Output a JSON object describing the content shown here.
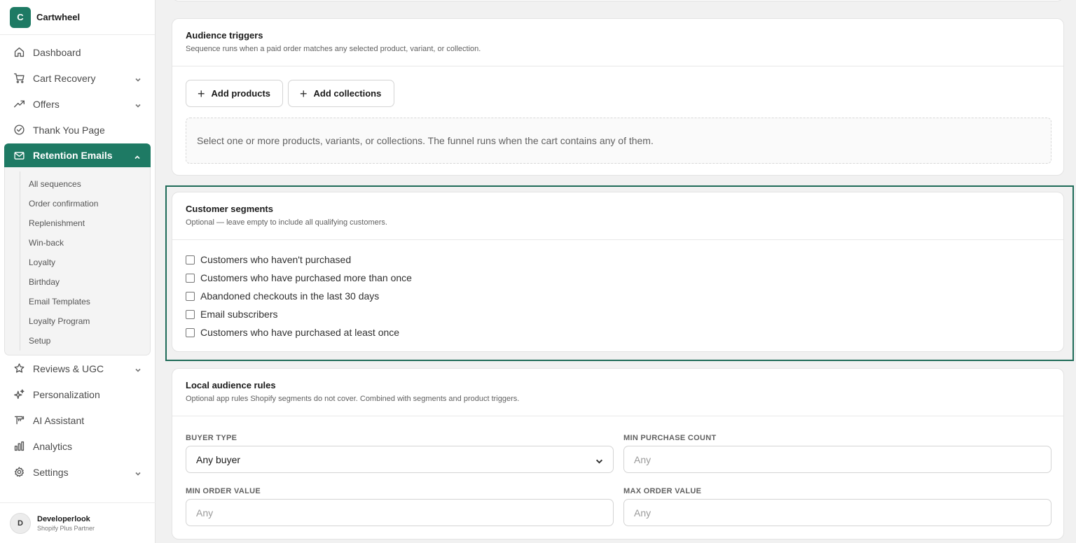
{
  "app": {
    "logo_letter": "C",
    "name": "Cartwheel"
  },
  "nav": {
    "dashboard": "Dashboard",
    "cart_recovery": "Cart Recovery",
    "offers": "Offers",
    "thank_you": "Thank You Page",
    "retention": "Retention Emails",
    "reviews": "Reviews & UGC",
    "personalization": "Personalization",
    "ai_assistant": "AI Assistant",
    "analytics": "Analytics",
    "settings": "Settings"
  },
  "subnav": [
    "All sequences",
    "Order confirmation",
    "Replenishment",
    "Win-back",
    "Loyalty",
    "Birthday",
    "Email Templates",
    "Loyalty Program",
    "Setup"
  ],
  "user": {
    "initial": "D",
    "name": "Developerlook",
    "role": "Shopify Plus Partner"
  },
  "audience": {
    "title": "Audience triggers",
    "subtitle": "Sequence runs when a paid order matches any selected product, variant, or collection.",
    "add_products": "Add products",
    "add_collections": "Add collections",
    "empty_hint": "Select one or more products, variants, or collections. The funnel runs when the cart contains any of them."
  },
  "segments": {
    "title": "Customer segments",
    "subtitle": "Optional — leave empty to include all qualifying customers.",
    "options": [
      "Customers who haven't purchased",
      "Customers who have purchased more than once",
      "Abandoned checkouts in the last 30 days",
      "Email subscribers",
      "Customers who have purchased at least once"
    ]
  },
  "local_rules": {
    "title": "Local audience rules",
    "subtitle": "Optional app rules Shopify segments do not cover. Combined with segments and product triggers.",
    "buyer_type_label": "BUYER TYPE",
    "buyer_type_value": "Any buyer",
    "min_purchase_label": "MIN PURCHASE COUNT",
    "min_purchase_placeholder": "Any",
    "min_order_label": "MIN ORDER VALUE",
    "min_order_placeholder": "Any",
    "max_order_label": "MAX ORDER VALUE",
    "max_order_placeholder": "Any"
  },
  "colors": {
    "accent": "#1e7a64",
    "highlight_border": "#1e6b58"
  }
}
